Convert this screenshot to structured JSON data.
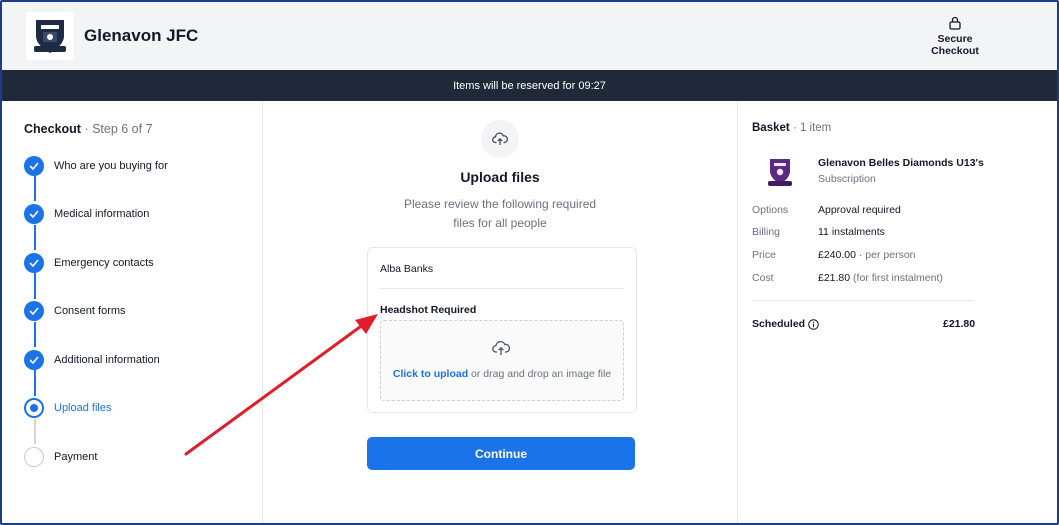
{
  "header": {
    "club_name": "Glenavon JFC",
    "secure_line1": "Secure",
    "secure_line2": "Checkout"
  },
  "banner": {
    "reserved_text": "Items will be reserved for 09:27"
  },
  "checkout": {
    "title": "Checkout",
    "step_text": "· Step 6 of 7",
    "steps": [
      {
        "label": "Who are you buying for",
        "status": "done"
      },
      {
        "label": "Medical information",
        "status": "done"
      },
      {
        "label": "Emergency contacts",
        "status": "done"
      },
      {
        "label": "Consent forms",
        "status": "done"
      },
      {
        "label": "Additional information",
        "status": "done"
      },
      {
        "label": "Upload files",
        "status": "current"
      },
      {
        "label": "Payment",
        "status": "todo"
      }
    ]
  },
  "upload": {
    "title": "Upload files",
    "description": "Please review the following required files for all people",
    "person_name": "Alba Banks",
    "requirement": "Headshot Required",
    "click_to_upload": "Click to upload",
    "drag_text": " or drag and drop an image file",
    "continue_label": "Continue"
  },
  "basket": {
    "title": "Basket",
    "count_text": "· 1 item",
    "product_name": "Glenavon Belles Diamonds U13's",
    "product_type": "Subscription",
    "rows": [
      {
        "key": "Options",
        "value": "Approval required",
        "muted": ""
      },
      {
        "key": "Billing",
        "value": "11 instalments",
        "muted": ""
      },
      {
        "key": "Price",
        "value": "£240.00",
        "muted": " · per person"
      },
      {
        "key": "Cost",
        "value": "£21.80",
        "muted": " (for first instalment)"
      }
    ],
    "scheduled_label": "Scheduled",
    "scheduled_amount": "£21.80"
  },
  "colors": {
    "accent": "#1a73e8",
    "banner_bg": "#1f2937",
    "annotation_arrow": "#e11d2a",
    "frame_border": "#1e3a8a"
  },
  "icons": {
    "club_logo": "club-crest-icon",
    "secure": "lock-icon",
    "upload": "cloud-upload-icon",
    "check": "check-icon",
    "info": "info-icon"
  }
}
